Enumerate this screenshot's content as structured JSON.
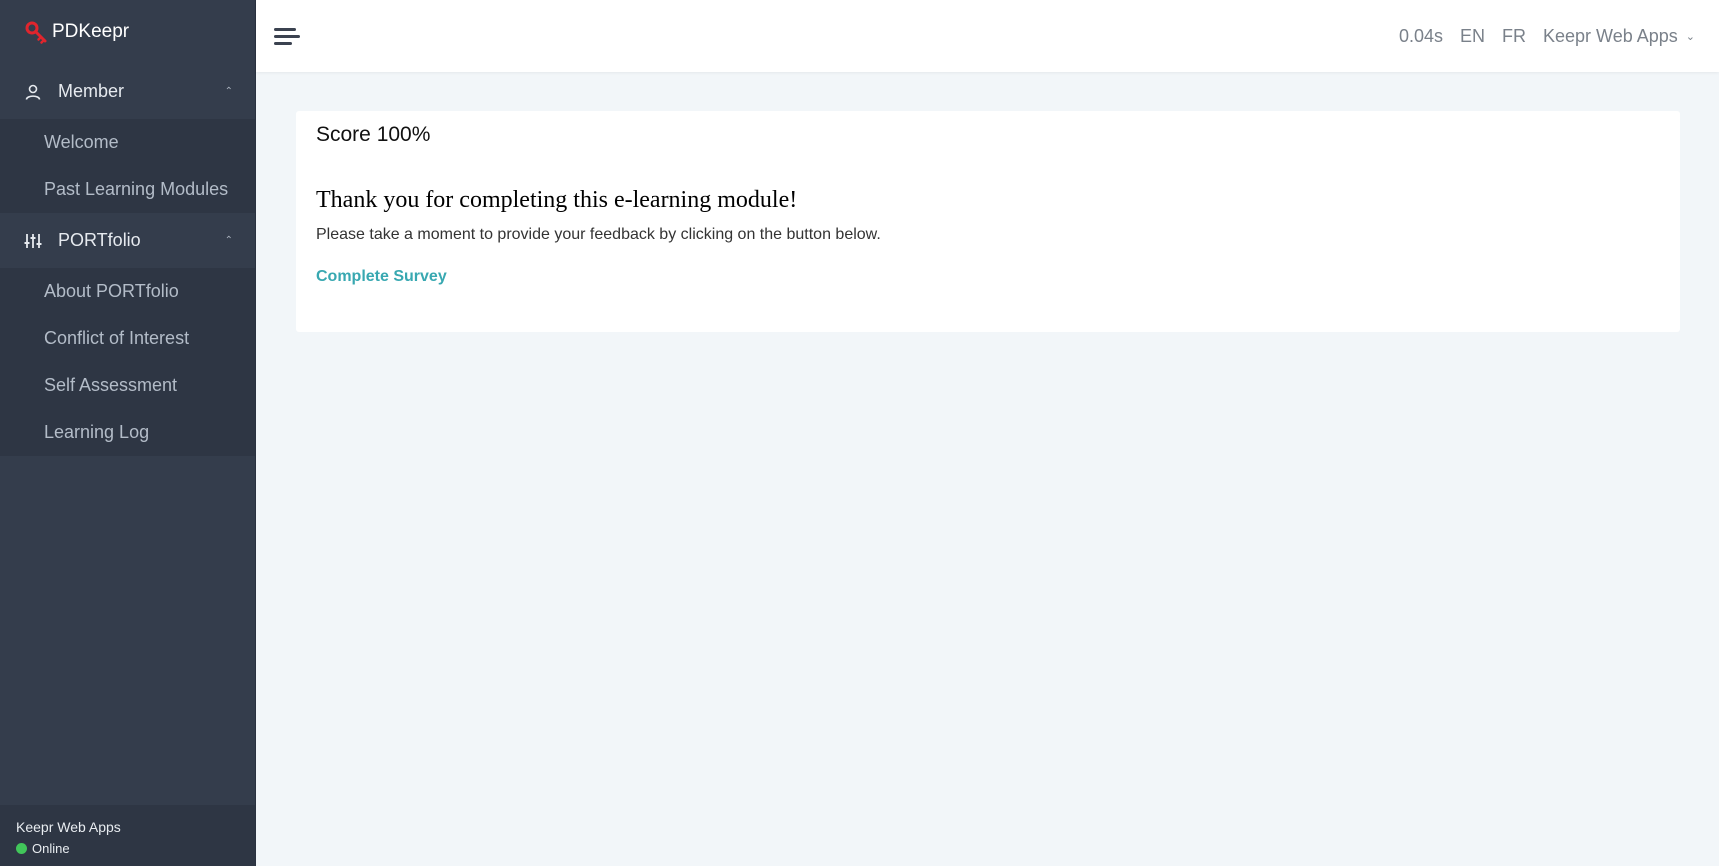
{
  "brand": {
    "name": "PDKeepr",
    "icon": "key-icon",
    "icon_color": "#e0252d"
  },
  "sidebar": {
    "groups": [
      {
        "label": "Member",
        "icon": "user-icon",
        "items": [
          {
            "label": "Welcome"
          },
          {
            "label": "Past Learning Modules"
          }
        ]
      },
      {
        "label": "PORTfolio",
        "icon": "sliders-icon",
        "items": [
          {
            "label": "About PORTfolio"
          },
          {
            "label": "Conflict of Interest"
          },
          {
            "label": "Self Assessment"
          },
          {
            "label": "Learning Log"
          }
        ]
      }
    ],
    "footer": {
      "org": "Keepr Web Apps",
      "status": "Online",
      "status_color": "#41c65a"
    }
  },
  "header": {
    "timing": "0.04s",
    "lang_en": "EN",
    "lang_fr": "FR",
    "user_menu": "Keepr Web Apps"
  },
  "main": {
    "score": "Score 100%",
    "heading": "Thank you for completing this e-learning module!",
    "message": "Please take a moment to provide your feedback by clicking on the button below.",
    "survey_link": "Complete Survey",
    "link_color": "#38a8b1"
  }
}
